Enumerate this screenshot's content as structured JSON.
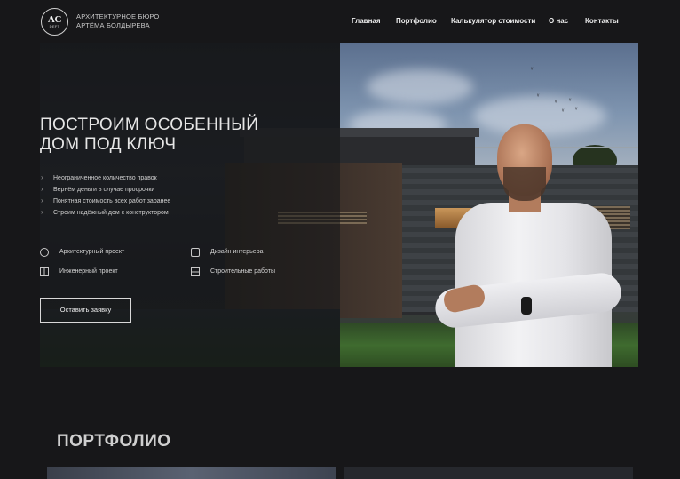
{
  "header": {
    "logo_mark": "AC",
    "logo_sub": "DEFT",
    "brand_line1": "АРХИТЕКТУРНОЕ БЮРО",
    "brand_line2": "АРТЁМА БОЛДЫРЕВА",
    "nav": [
      "Главная",
      "Портфолио",
      "Калькулятор стоимости",
      "О нас",
      "Контакты"
    ]
  },
  "hero": {
    "title_line1": "ПОСТРОИМ ОСОБЕННЫЙ",
    "title_line2": "ДОМ ПОД КЛЮЧ",
    "bullets": [
      "Неограниченное количество правок",
      "Вернём деньги в случае просрочки",
      "Понятная стоимость всех работ заранее",
      "Строим надёжный дом с конструктором"
    ],
    "services": [
      {
        "label": "Архитектурный проект",
        "icon": "compass-icon"
      },
      {
        "label": "Дизайн интерьера",
        "icon": "paint-bucket-icon"
      },
      {
        "label": "Инженерный проект",
        "icon": "blueprint-icon"
      },
      {
        "label": "Строительные работы",
        "icon": "bricks-icon"
      }
    ],
    "cta": "Оставить заявку"
  },
  "portfolio": {
    "title": "ПОРТФОЛИО"
  },
  "colors": {
    "background": "#171719",
    "text": "#e8e8e8",
    "border": "#d8d8d8"
  }
}
